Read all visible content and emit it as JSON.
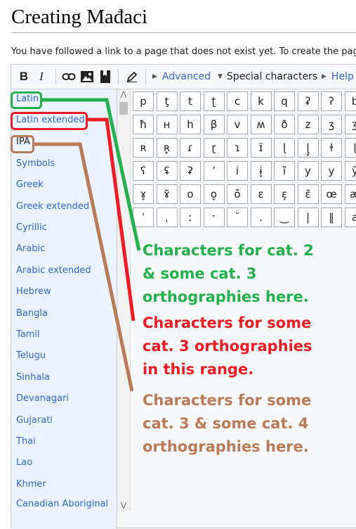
{
  "page": {
    "title": "Creating Mađaci",
    "notice": "You have followed a link to a page that does not exist yet. To create the page,"
  },
  "toolbar": {
    "bold": "B",
    "italic": "I",
    "advanced": "Advanced",
    "special": "Special characters",
    "help": "Help"
  },
  "categories": [
    "Latin",
    "Latin extended",
    "IPA",
    "Symbols",
    "Greek",
    "Greek extended",
    "Cyrillic",
    "Arabic",
    "Arabic extended",
    "Hebrew",
    "Bangla",
    "Tamil",
    "Telugu",
    "Sinhala",
    "Devanagari",
    "Gujarati",
    "Thai",
    "Lao",
    "Khmer",
    "Canadian Aboriginal"
  ],
  "characters": [
    [
      "p",
      "ƫ",
      "t",
      "ʈ",
      "c",
      "k",
      "q",
      "ʡ",
      "ʔ",
      "b"
    ],
    [
      "ħ",
      "ʜ",
      "h",
      "β",
      "v",
      "ʍ",
      "ð",
      "z",
      "ʒ",
      "ʒ"
    ],
    [
      "ʀ",
      "ʀ̥",
      "ɾ",
      "ɽ",
      "ɿ",
      "ɪ̈",
      "ɭ",
      "ɭ̥",
      "ɫ",
      "ɭ"
    ],
    [
      "ʕ",
      "ʢ",
      "ʡ",
      "ʼ",
      "i",
      "ɨ̞",
      "ĩ",
      "y",
      "y",
      "ỹ"
    ],
    [
      "ɤ̞",
      "ɤ̃",
      "o",
      "o̞",
      "õ",
      "ɛ",
      "ɛ̞",
      "ɛ̃",
      "œ",
      "æ"
    ],
    [
      "ˈ",
      "ˌ",
      "ː",
      "ˑ",
      "˘",
      ".",
      "‿",
      "|",
      "‖",
      "a"
    ]
  ],
  "annotations": {
    "green": "Characters for cat. 2\n& some cat. 3\northographies here.",
    "red": "Characters for some\ncat. 3 orthographies\nin this range.",
    "brown": "Characters for some\ncat. 3 & some cat. 4\northographies here."
  },
  "colors": {
    "green": "#22b14c",
    "red": "#ed1c24",
    "brown": "#b97a57",
    "link": "#3366cc"
  },
  "icons": [
    "link-icon",
    "image-icon",
    "gallery-icon",
    "pencil-icon",
    "triangle-right-icon",
    "triangle-down-icon",
    "chevron-up-icon",
    "chevron-down-icon"
  ]
}
